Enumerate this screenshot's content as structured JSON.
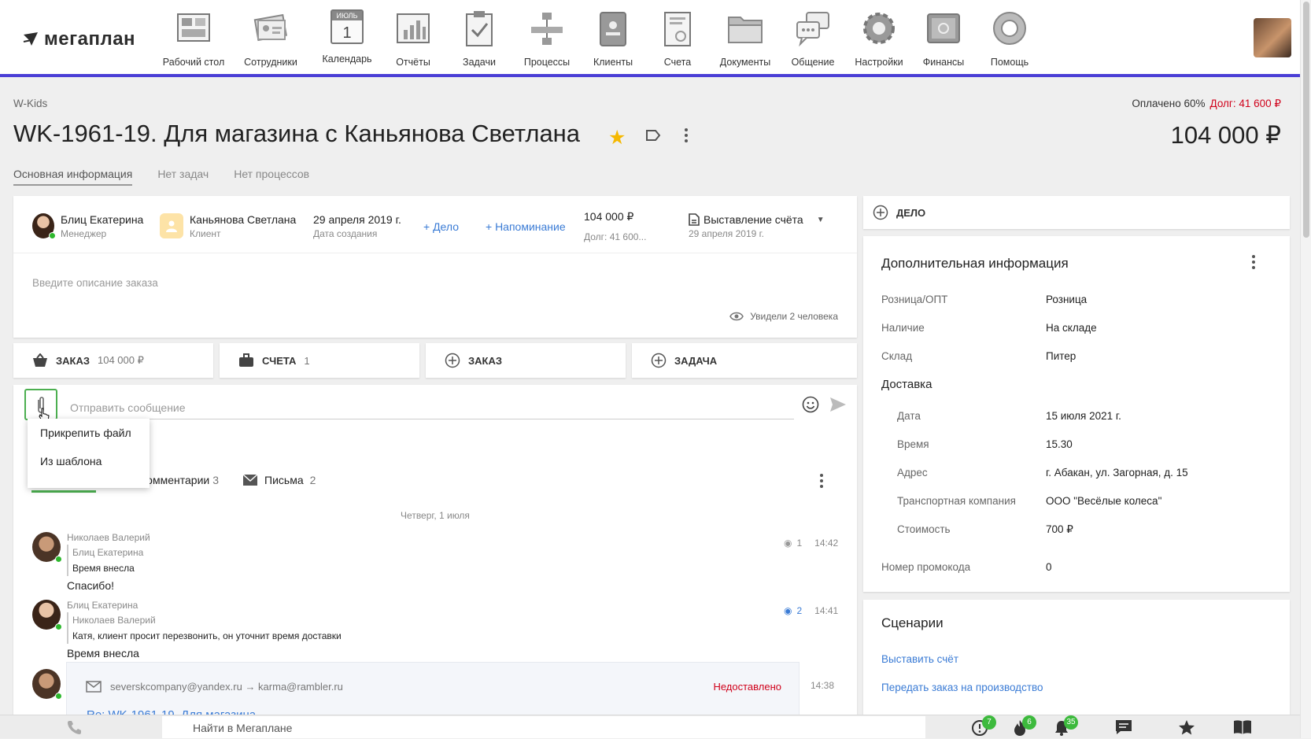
{
  "app": {
    "logo_text": "мегаплан"
  },
  "nav": [
    {
      "label": "Рабочий стол",
      "icon": "desktop-icon"
    },
    {
      "label": "Сотрудники",
      "icon": "employees-icon"
    },
    {
      "label": "Календарь",
      "icon": "calendar-icon",
      "cal_month": "ИЮЛЬ",
      "cal_day": "1"
    },
    {
      "label": "Отчёты",
      "icon": "reports-icon"
    },
    {
      "label": "Задачи",
      "icon": "tasks-icon"
    },
    {
      "label": "Процессы",
      "icon": "processes-icon"
    },
    {
      "label": "Клиенты",
      "icon": "clients-icon"
    },
    {
      "label": "Счета",
      "icon": "invoices-icon"
    },
    {
      "label": "Документы",
      "icon": "documents-icon"
    },
    {
      "label": "Общение",
      "icon": "chat-icon"
    },
    {
      "label": "Настройки",
      "icon": "settings-icon"
    },
    {
      "label": "Финансы",
      "icon": "finance-icon"
    },
    {
      "label": "Помощь",
      "icon": "help-icon"
    }
  ],
  "breadcrumb": "W-Kids",
  "payment": {
    "paid": "Оплачено 60%",
    "debt": "Долг: 41 600 ₽"
  },
  "title": "WK-1961-19. Для магазина с Каньянова Светлана",
  "total_price": "104 000 ₽",
  "tabs": [
    "Основная информация",
    "Нет задач",
    "Нет процессов"
  ],
  "deal": {
    "manager_name": "Блиц Екатерина",
    "manager_role": "Менеджер",
    "client_name": "Каньянова Светлана",
    "client_role": "Клиент",
    "created_date": "29 апреля 2019 г.",
    "created_label": "Дата создания",
    "add_case": "+ Дело",
    "add_reminder": "+ Напоминание",
    "sum": "104 000 ₽",
    "debt": "Долг: 41 600...",
    "stage": "Выставление счёта",
    "stage_date": "29 апреля 2019 г.",
    "description_placeholder": "Введите описание заказа",
    "seen": "Увидели 2 человека"
  },
  "blocks": [
    {
      "label": "ЗАКАЗ",
      "count": "104 000 ₽"
    },
    {
      "label": "СЧЕТА",
      "count": "1"
    },
    {
      "label": "ЗАКАЗ",
      "count": ""
    },
    {
      "label": "ЗАДАЧА",
      "count": ""
    }
  ],
  "composer": {
    "placeholder": "Отправить сообщение"
  },
  "attach_menu": [
    "Прикрепить файл",
    "Из шаблона"
  ],
  "feed_tabs": [
    {
      "label": "Комментарии",
      "count": "3"
    },
    {
      "label": "Письма",
      "count": "2"
    }
  ],
  "date_separator": "Четверг, 1 июля",
  "messages": [
    {
      "author": "Николаев Валерий",
      "quote_author": "Блиц Екатерина",
      "quote_text": "Время внесла",
      "text": "Спасибо!",
      "views": "1",
      "time": "14:42"
    },
    {
      "author": "Блиц Екатерина",
      "quote_author": "Николаев Валерий",
      "quote_text": "Катя, клиент просит перезвонить, он уточнит время доставки",
      "text": "Время внесла",
      "views": "2",
      "time": "14:41"
    }
  ],
  "mail": {
    "route": "severskcompany@yandex.ru → karma@rambler.ru",
    "status": "Недоставлено",
    "time": "14:38",
    "subject": "Re: WK-1961-19. Для магазина"
  },
  "right_case": "ДЕЛО",
  "additional": {
    "title": "Дополнительная информация",
    "rows": [
      {
        "k": "Розница/ОПТ",
        "v": "Розница"
      },
      {
        "k": "Наличие",
        "v": "На складе"
      },
      {
        "k": "Склад",
        "v": "Питер"
      }
    ],
    "delivery_title": "Доставка",
    "delivery": [
      {
        "k": "Дата",
        "v": "15 июля 2021 г."
      },
      {
        "k": "Время",
        "v": "15.30"
      },
      {
        "k": "Адрес",
        "v": "г. Абакан, ул. Загорная, д. 15"
      },
      {
        "k": "Транспортная компания",
        "v": "ООО \"Весёлые колеса\""
      },
      {
        "k": "Стоимость",
        "v": "700 ₽"
      }
    ],
    "promo": {
      "k": "Номер промокода",
      "v": "0"
    }
  },
  "scenarios": {
    "title": "Сценарии",
    "links": [
      "Выставить счёт",
      "Передать заказ на производство"
    ]
  },
  "bottom": {
    "search": "Найти в Мегаплане",
    "badges": [
      "7",
      "6",
      "35"
    ]
  },
  "colors": {
    "accent": "#4b3fd6",
    "link": "#3a7bd5",
    "danger": "#d0021b",
    "success": "#4caf50",
    "star": "#f5b800"
  }
}
